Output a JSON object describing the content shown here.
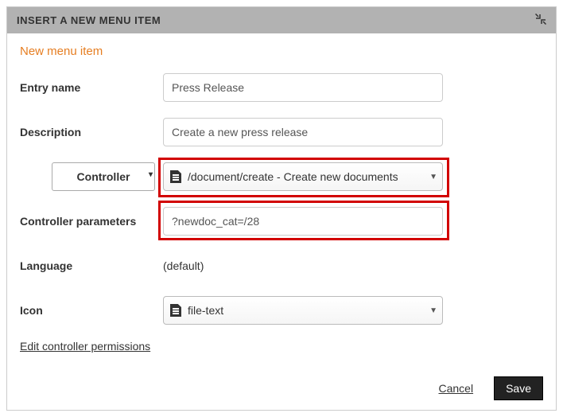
{
  "header": {
    "title": "INSERT A NEW MENU ITEM"
  },
  "section_title": "New menu item",
  "labels": {
    "entry_name": "Entry name",
    "description": "Description",
    "controller_params": "Controller parameters",
    "language": "Language",
    "icon": "Icon"
  },
  "values": {
    "entry_name": "Press Release",
    "description": "Create a new press release",
    "controller_type": "Controller",
    "controller_path": "/document/create - Create new documents",
    "controller_params": "?newdoc_cat=/28",
    "language": "(default)",
    "icon_name": "file-text"
  },
  "links": {
    "edit_permissions": "Edit controller permissions"
  },
  "buttons": {
    "cancel": "Cancel",
    "save": "Save"
  }
}
